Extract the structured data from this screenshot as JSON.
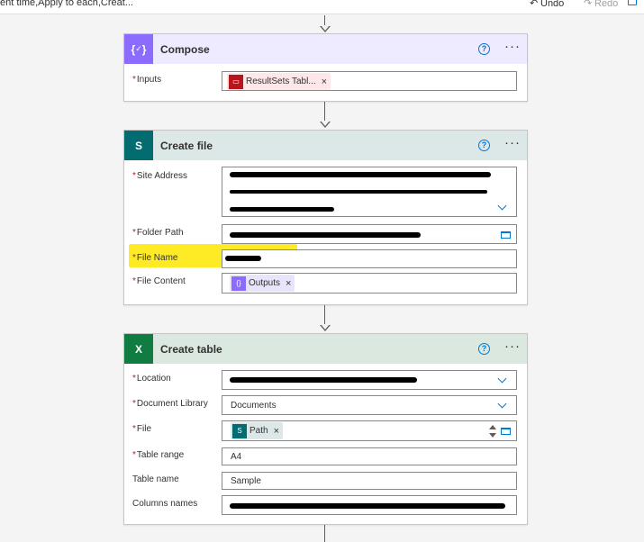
{
  "toolbar": {
    "breadcrumb": "ent time,Apply to each,Creat...",
    "undo_label": "Undo",
    "redo_label": "Redo"
  },
  "colors": {
    "compose_accent": "#8c6cff",
    "compose_header_bg": "#eeeaff",
    "sharepoint_accent": "#036c70",
    "sharepoint_header_bg": "#dce7e8",
    "excel_accent": "#107c41",
    "excel_header_bg": "#dbe8e0",
    "help_blue": "#0078d4",
    "required_red": "#a4262c",
    "highlight_yellow": "#ffe600"
  },
  "cards": {
    "compose": {
      "title": "Compose",
      "icon": "braces-icon",
      "fields": {
        "inputs_label": "Inputs",
        "inputs_token": "ResultSets Tabl..."
      }
    },
    "create_file": {
      "title": "Create file",
      "icon": "sharepoint-icon",
      "fields": {
        "site_address_label": "Site Address",
        "folder_path_label": "Folder Path",
        "file_name_label": "File Name",
        "file_content_label": "File Content",
        "file_content_token": "Outputs"
      }
    },
    "create_table": {
      "title": "Create table",
      "icon": "excel-icon",
      "fields": {
        "location_label": "Location",
        "document_library_label": "Document Library",
        "document_library_value": "Documents",
        "file_label": "File",
        "file_token": "Path",
        "table_range_label": "Table range",
        "table_range_value": "A4",
        "table_name_label": "Table name",
        "table_name_value": "Sample",
        "columns_names_label": "Columns names"
      }
    }
  }
}
